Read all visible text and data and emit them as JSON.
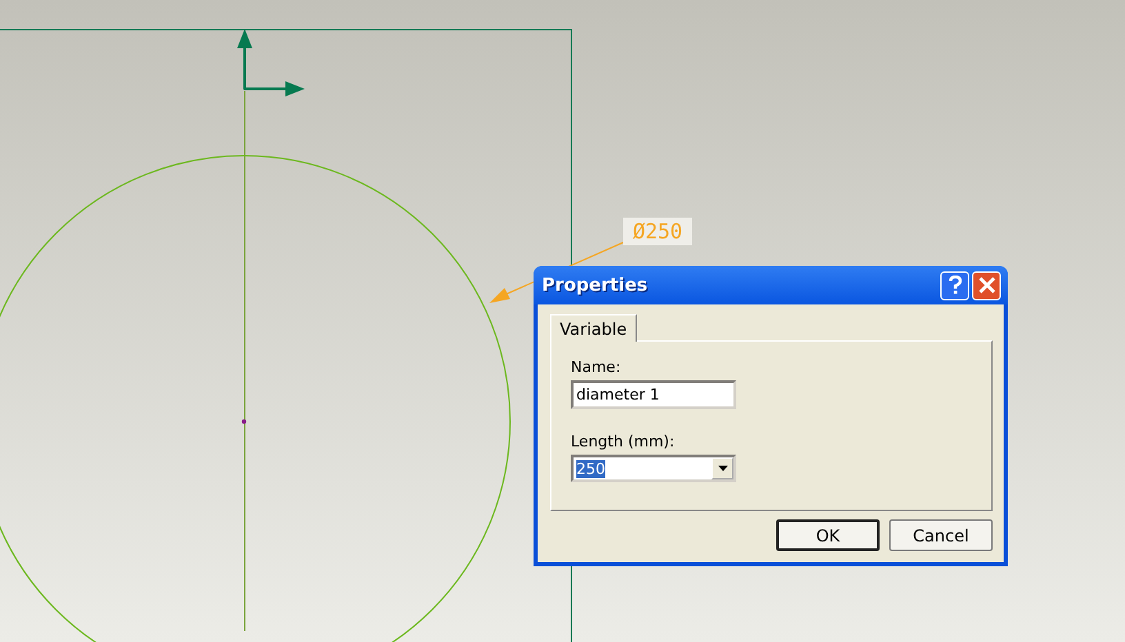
{
  "dimension_label": "Ø250",
  "dialog": {
    "title": "Properties",
    "tabs": [
      {
        "label": "Variable",
        "selected": true
      }
    ],
    "fields": [
      {
        "kind": "text",
        "label": "Name:",
        "value": "diameter 1"
      },
      {
        "kind": "combo",
        "label": "Length (mm):",
        "value": "250",
        "text_selected": true
      }
    ],
    "buttons": [
      {
        "label": "OK",
        "default": true
      },
      {
        "label": "Cancel",
        "default": false
      }
    ]
  }
}
